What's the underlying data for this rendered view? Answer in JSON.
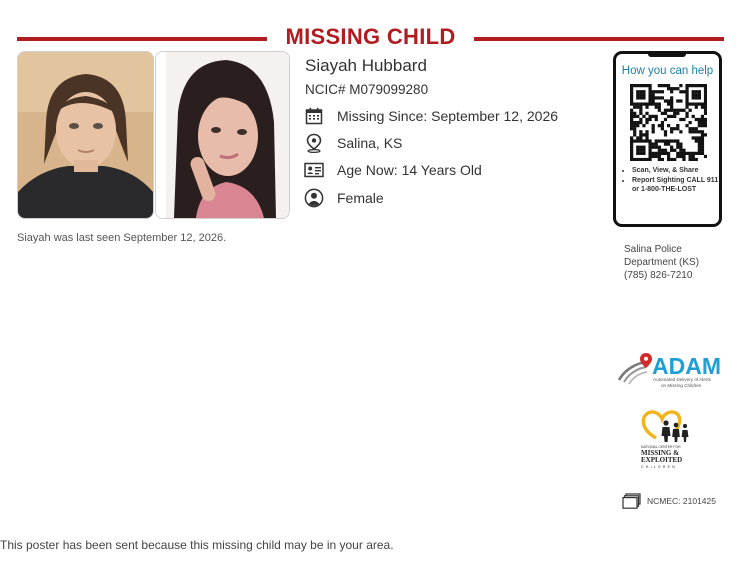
{
  "poster": {
    "title": "MISSING CHILD",
    "name": "Siayah Hubbard",
    "ncic": "NCIC# M079099280",
    "missing_since": "Missing Since: September 12, 2026",
    "location": "Salina, KS",
    "age_now": "Age Now: 14 Years Old",
    "sex": "Female",
    "last_seen": "Siayah was last seen September 12, 2026.",
    "accent_color": "#b01c20",
    "icons": [
      "calendar-icon",
      "location-pin-icon",
      "id-card-icon",
      "person-icon"
    ]
  },
  "phone_card": {
    "heading": "How you can help",
    "bullets": [
      "Scan, View, & Share",
      "Report Sighting CALL 911 or 1-800-THE-LOST"
    ]
  },
  "agency": {
    "line1": "Salina Police",
    "line2": "Department (KS)",
    "phone": "(785) 826-7210"
  },
  "logos": {
    "adam_word": "ADAM",
    "adam_tagline1": "Automated Delivery of Alerts",
    "adam_tagline2": "on Missing Children",
    "ncmec_line1": "NATIONAL CENTER FOR",
    "ncmec_line2": "MISSING &",
    "ncmec_line3": "EXPLOITED",
    "ncmec_line4": "CHILDREN"
  },
  "case": {
    "label": "NCMEC: 2101425"
  },
  "footer": {
    "text": "This poster has been sent because this missing child may be in your area."
  }
}
